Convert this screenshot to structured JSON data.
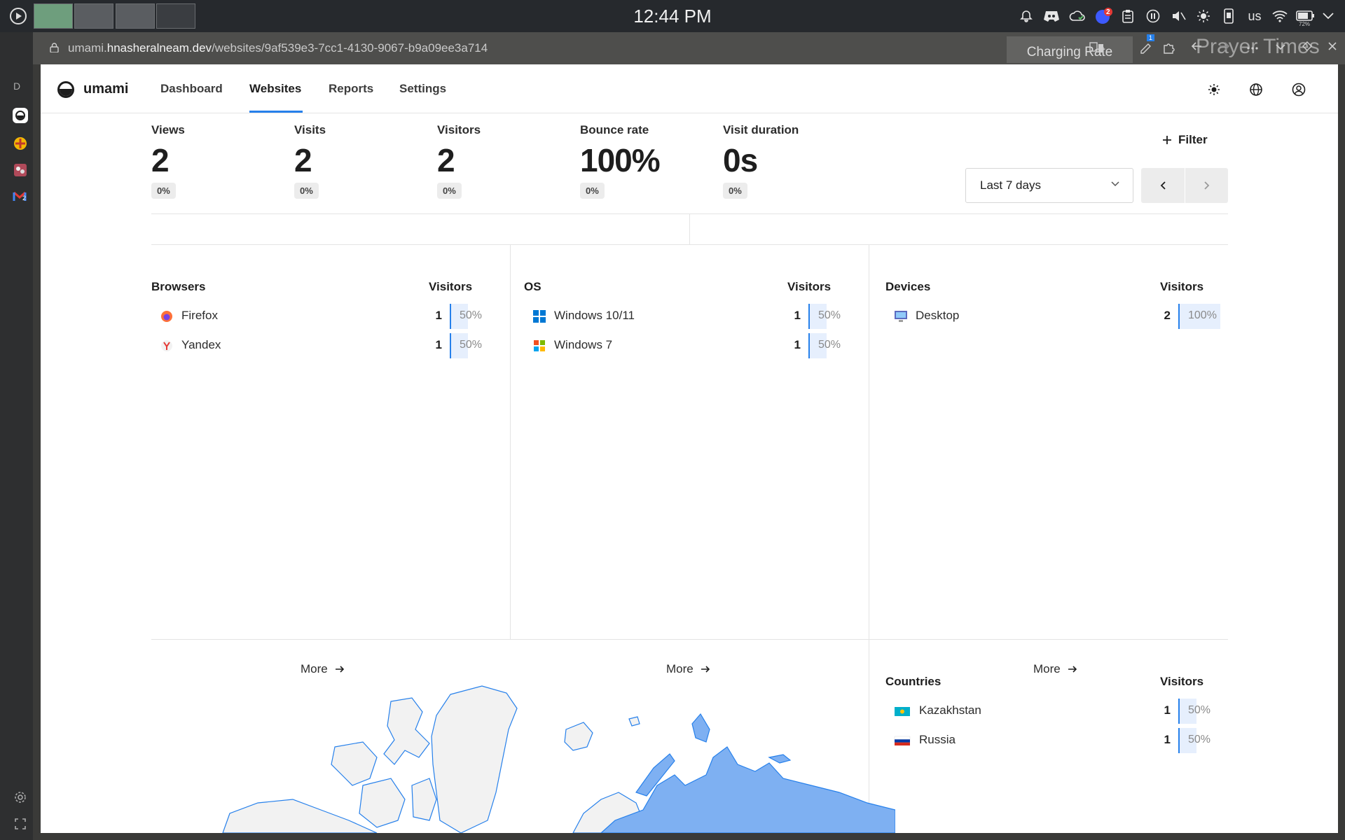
{
  "system": {
    "clock": "12:44 PM",
    "keyboard_layout": "us",
    "notification_count": "2",
    "battery_percent": "72%",
    "workspaces": [
      "#6e9e7d",
      "#5a5d61",
      "#5a5d61",
      "#3a3d41"
    ]
  },
  "dock": {
    "label_letter": "D",
    "badge": "2"
  },
  "browser": {
    "url_prefix": "umami.",
    "url_domain": "hnasheralneam.dev",
    "url_path": "/websites/9af539e3-7cc1-4130-9067-b9a09ee3a714",
    "extension_badge": "1",
    "charging_label": "Charging Rate",
    "prayer_label": "Prayer Times"
  },
  "app": {
    "brand": "umami",
    "nav": [
      "Dashboard",
      "Websites",
      "Reports",
      "Settings"
    ],
    "active_tab": "Websites"
  },
  "metrics": [
    {
      "label": "Views",
      "value": "2",
      "change": "0%"
    },
    {
      "label": "Visits",
      "value": "2",
      "change": "0%"
    },
    {
      "label": "Visitors",
      "value": "2",
      "change": "0%"
    },
    {
      "label": "Bounce rate",
      "value": "100%",
      "change": "0%"
    },
    {
      "label": "Visit duration",
      "value": "0s",
      "change": "0%"
    }
  ],
  "controls": {
    "filter_label": "Filter",
    "date_range": "Last 7 days"
  },
  "browsers": {
    "title": "Browsers",
    "col": "Visitors",
    "more": "More",
    "rows": [
      {
        "name": "Firefox",
        "count": "1",
        "pct": "50%",
        "frac": 0.5
      },
      {
        "name": "Yandex",
        "count": "1",
        "pct": "50%",
        "frac": 0.5
      }
    ]
  },
  "os": {
    "title": "OS",
    "col": "Visitors",
    "more": "More",
    "rows": [
      {
        "name": "Windows 10/11",
        "count": "1",
        "pct": "50%",
        "frac": 0.5
      },
      {
        "name": "Windows 7",
        "count": "1",
        "pct": "50%",
        "frac": 0.5
      }
    ]
  },
  "devices": {
    "title": "Devices",
    "col": "Visitors",
    "more": "More",
    "rows": [
      {
        "name": "Desktop",
        "count": "2",
        "pct": "100%",
        "frac": 1.0
      }
    ]
  },
  "countries": {
    "title": "Countries",
    "col": "Visitors",
    "rows": [
      {
        "name": "Kazakhstan",
        "count": "1",
        "pct": "50%",
        "frac": 0.5
      },
      {
        "name": "Russia",
        "count": "1",
        "pct": "50%",
        "frac": 0.5
      }
    ]
  },
  "colors": {
    "accent": "#2680eb",
    "map_highlight": "#7eb0f2",
    "map_base": "#f2f2f2"
  }
}
